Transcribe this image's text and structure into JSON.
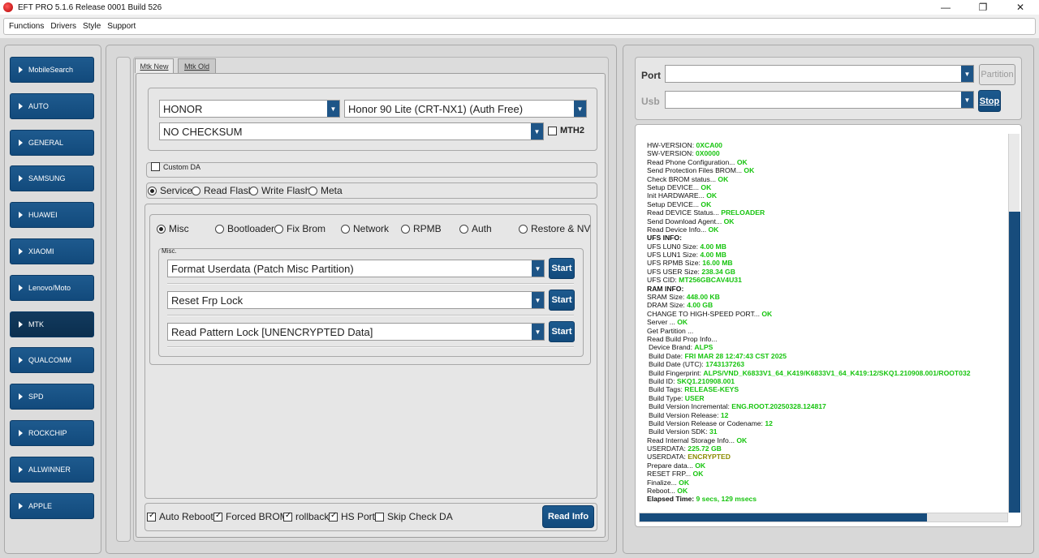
{
  "window": {
    "title": "EFT PRO 5.1.6 Release 0001 Build 526",
    "controls": {
      "minimize": "—",
      "maximize": "❐",
      "close": "✕"
    }
  },
  "menu": [
    "Functions",
    "Drivers",
    "Style",
    "Support"
  ],
  "sidebar": {
    "items": [
      {
        "label": "MobileSearch"
      },
      {
        "label": "AUTO"
      },
      {
        "label": "GENERAL"
      },
      {
        "label": "SAMSUNG"
      },
      {
        "label": "HUAWEI"
      },
      {
        "label": "XIAOMI"
      },
      {
        "label": "Lenovo/Moto"
      },
      {
        "label": "MTK",
        "active": true
      },
      {
        "label": "QUALCOMM"
      },
      {
        "label": "SPD"
      },
      {
        "label": "ROCKCHIP"
      },
      {
        "label": "ALLWINNER"
      },
      {
        "label": "APPLE"
      }
    ]
  },
  "tabs": [
    {
      "label": "Mtk New",
      "active": true
    },
    {
      "label": "Mtk Old",
      "active": false
    }
  ],
  "device": {
    "brand": "HONOR",
    "model": "Honor 90 Lite (CRT-NX1) (Auth Free)",
    "checksum": "NO CHECKSUM",
    "mth2_label": "MTH2",
    "mth2_checked": false
  },
  "custom_da": {
    "label": "Custom DA",
    "checked": false
  },
  "modes": {
    "selected": "Service",
    "options": [
      "Service",
      "Read Flash",
      "Write Flash",
      "Meta"
    ]
  },
  "service_tabs": {
    "selected": "Misc",
    "options": [
      "Misc",
      "Bootloader",
      "Fix Brom",
      "Network",
      "RPMB",
      "Auth",
      "Restore & NV"
    ]
  },
  "misc": {
    "group_label": "Misc.",
    "start_label": "Start",
    "operations": [
      "Format Userdata (Patch Misc Partition)",
      "Reset Frp Lock",
      "Read Pattern Lock [UNENCRYPTED Data]"
    ]
  },
  "options_bar": {
    "items": [
      {
        "label": "Auto Reboot",
        "checked": true
      },
      {
        "label": "Forced BROM",
        "checked": true
      },
      {
        "label": "rollback",
        "checked": true
      },
      {
        "label": "HS Port",
        "checked": true
      },
      {
        "label": "Skip Check DA",
        "checked": false
      }
    ],
    "read_info_label": "Read Info"
  },
  "connection": {
    "port_label": "Port",
    "usb_label": "Usb",
    "port_value": "",
    "usb_value": "",
    "partition_label": "Partition",
    "stop_label": "Stop"
  },
  "log": [
    {
      "k": "HW-VERSION: ",
      "v": "0XCA00"
    },
    {
      "k": "SW-VERSION: ",
      "v": "0X0000"
    },
    {
      "k": "Read Phone Configuration... ",
      "v": "OK"
    },
    {
      "k": "Send Protection Files BROM... ",
      "v": "OK"
    },
    {
      "k": "Check BROM status... ",
      "v": "OK"
    },
    {
      "k": "Setup DEVICE... ",
      "v": "OK"
    },
    {
      "k": "Init HARDWARE... ",
      "v": "OK"
    },
    {
      "k": "Setup DEVICE... ",
      "v": "OK"
    },
    {
      "k": "Read DEVICE Status... ",
      "v": "PRELOADER"
    },
    {
      "k": "Send Download Agent... ",
      "v": "OK"
    },
    {
      "k": "Read Device Info... ",
      "v": "OK"
    },
    {
      "k": "UFS INFO:",
      "v": "",
      "bold": true
    },
    {
      "k": "UFS LUN0 Size: ",
      "v": "4.00 MB"
    },
    {
      "k": "UFS LUN1 Size: ",
      "v": "4.00 MB"
    },
    {
      "k": "UFS RPMB Size: ",
      "v": "16.00 MB"
    },
    {
      "k": "UFS USER Size: ",
      "v": "238.34 GB"
    },
    {
      "k": "UFS CID: ",
      "v": "MT256GBCAV4U31"
    },
    {
      "k": "RAM INFO:",
      "v": "",
      "bold": true
    },
    {
      "k": "SRAM Size: ",
      "v": "448.00 KB"
    },
    {
      "k": "DRAM Size: ",
      "v": "4.00 GB"
    },
    {
      "k": "CHANGE TO HIGH-SPEED PORT... ",
      "v": "OK"
    },
    {
      "k": "Server ... ",
      "v": "OK"
    },
    {
      "k": "Get Partition ...",
      "v": ""
    },
    {
      "k": "Read Build Prop Info...",
      "v": ""
    },
    {
      "k": " Device Brand: ",
      "v": "ALPS",
      "indent": true
    },
    {
      "k": " Build Date: ",
      "v": "FRI MAR 28 12:47:43 CST 2025",
      "indent": true
    },
    {
      "k": " Build Date (UTC): ",
      "v": "1743137263",
      "indent": true
    },
    {
      "k": " Build Fingerprint: ",
      "v": "ALPS/VND_K6833V1_64_K419/K6833V1_64_K419:12/SKQ1.210908.001/ROOT032",
      "indent": true
    },
    {
      "k": " Build ID: ",
      "v": "SKQ1.210908.001",
      "indent": true
    },
    {
      "k": " Build Tags: ",
      "v": "RELEASE-KEYS",
      "indent": true
    },
    {
      "k": " Build Type: ",
      "v": "USER",
      "indent": true
    },
    {
      "k": " Build Version Incremental: ",
      "v": "ENG.ROOT.20250328.124817",
      "indent": true
    },
    {
      "k": " Build Version Release: ",
      "v": "12",
      "indent": true
    },
    {
      "k": " Build Version Release or Codename: ",
      "v": "12",
      "indent": true
    },
    {
      "k": " Build Version SDK: ",
      "v": "31",
      "indent": true
    },
    {
      "k": "Read Internal Storage Info... ",
      "v": "OK"
    },
    {
      "k": "USERDATA: ",
      "v": "225.72 GB"
    },
    {
      "k": "USERDATA: ",
      "v": "ENCRYPTED",
      "olive": true
    },
    {
      "k": "Prepare data... ",
      "v": "OK"
    },
    {
      "k": "RESET FRP... ",
      "v": "OK"
    },
    {
      "k": "Finalize... ",
      "v": "OK"
    },
    {
      "k": "Reboot... ",
      "v": "OK"
    },
    {
      "k": "Elapsed Time: ",
      "v": "9 secs, 129 msecs",
      "bold": true
    }
  ],
  "colors": {
    "button_blue": "#1e5a8e",
    "log_ok_green": "#16c40e",
    "log_encrypted_olive": "#8b8b00"
  }
}
